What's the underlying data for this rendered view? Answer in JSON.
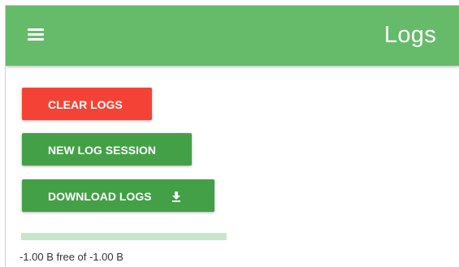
{
  "app_bar": {
    "title": "Logs",
    "menu_icon": "menu-icon"
  },
  "actions": {
    "clear_label": "CLEAR LOGS",
    "new_session_label": "NEW LOG SESSION",
    "download_label": "DOWNLOAD LOGS",
    "download_icon": "download-icon"
  },
  "storage": {
    "used_fraction": 0,
    "text": "-1.00 B free of -1.00 B"
  },
  "colors": {
    "app_bar": "#66bb6a",
    "clear_button": "#f44336",
    "primary_button": "#43a047",
    "storage_track": "#c8e6c9"
  }
}
